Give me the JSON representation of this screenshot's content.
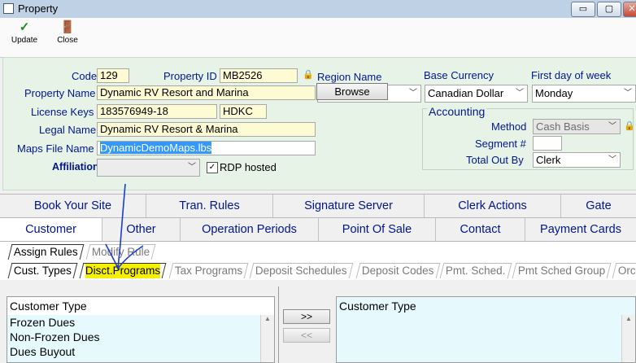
{
  "window": {
    "title": "Property",
    "min_glyph": "▭",
    "max_glyph": "▢",
    "close_glyph": "✕"
  },
  "toolbar": {
    "update_label": "Update",
    "close_label": "Close",
    "update_icon": "check-icon",
    "close_icon": "door-icon"
  },
  "form": {
    "code_label": "Code",
    "code_value": "129",
    "property_id_label": "Property ID",
    "property_id_value": "MB2526",
    "region_label": "Region Name",
    "region_value": "",
    "property_name_label": "Property Name",
    "property_name_value": "Dynamic RV Resort and Marina",
    "license_label": "License Keys",
    "license_value": "183576949-18",
    "license_code": "HDKC",
    "legal_label": "Legal Name",
    "legal_value": "Dynamic RV Resort & Marina",
    "maps_label": "Maps File Name",
    "maps_value": "DynamicDemoMaps.lbs",
    "browse_label": "Browse",
    "affiliation_label": "Affiliation",
    "affiliation_value": "",
    "rdp_label": "RDP hosted",
    "rdp_checked": true,
    "base_currency_label": "Base Currency",
    "base_currency_value": "Canadian Dollar",
    "first_day_label": "First day of week",
    "first_day_value": "Monday",
    "accounting_label": "Accounting",
    "method_label": "Method",
    "method_value": "Cash Basis",
    "segment_label": "Segment #",
    "segment_value": "",
    "total_out_label": "Total Out By",
    "total_out_value": "Clerk"
  },
  "tabs_row1": [
    "Book Your Site",
    "Tran. Rules",
    "Signature Server",
    "Clerk Actions",
    "Gate"
  ],
  "tabs_row2": [
    "Customer",
    "Other",
    "Operation Periods",
    "Point Of Sale",
    "Contact",
    "Payment Cards"
  ],
  "active_tab": "Customer",
  "subtabs1": [
    "Assign Rules",
    "Modify Rule"
  ],
  "subtabs2": [
    "Cust. Types",
    "Disct.Programs",
    "Tax Programs",
    "Deposit Schedules",
    "Deposit Codes",
    "Pmt. Sched.",
    "Pmt Sched Group",
    "Orc"
  ],
  "highlighted_subtab": "Disct.Programs",
  "left_list": {
    "header": "Customer Type",
    "items": [
      "Frozen Dues",
      "Non-Frozen Dues",
      "Dues Buyout"
    ]
  },
  "right_list": {
    "header": "Customer Type",
    "items": []
  },
  "transfer": {
    "add_label": ">>",
    "remove_label": "<<"
  },
  "colors": {
    "label_blue": "#00168a",
    "panel_green": "#e8f3e8",
    "highlight_yellow": "#f4f000",
    "annotation_blue": "#1a3ccf"
  }
}
